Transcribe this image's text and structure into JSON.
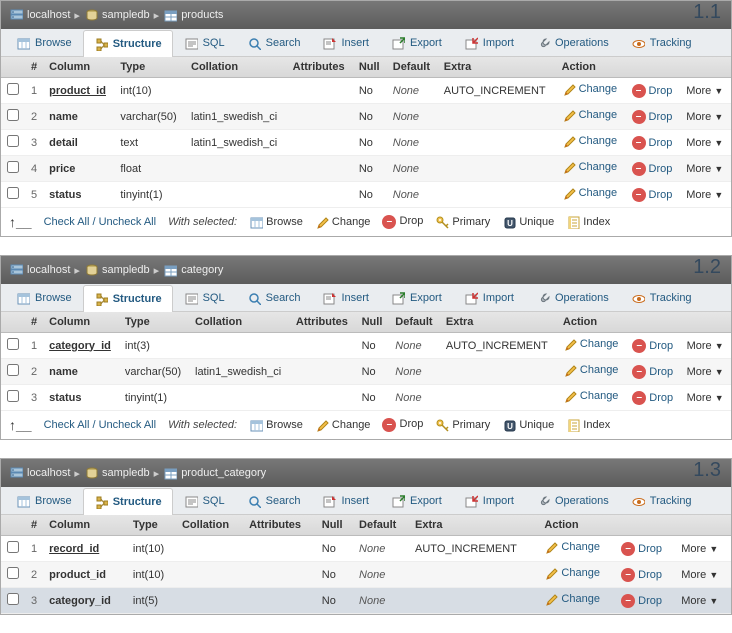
{
  "panels": [
    {
      "num": "1.1",
      "breadcrumb": {
        "host": "localhost",
        "db": "sampledb",
        "table": "products"
      },
      "tabs": {
        "browse": "Browse",
        "structure": "Structure",
        "sql": "SQL",
        "search": "Search",
        "insert": "Insert",
        "export": "Export",
        "import": "Import",
        "operations": "Operations",
        "tracking": "Tracking",
        "active": "structure"
      },
      "headers": {
        "num": "#",
        "column": "Column",
        "type": "Type",
        "collation": "Collation",
        "attributes": "Attributes",
        "null": "Null",
        "default": "Default",
        "extra": "Extra",
        "action": "Action"
      },
      "rows": [
        {
          "n": "1",
          "col": "product_id",
          "pk": true,
          "type": "int(10)",
          "coll": "",
          "attr": "",
          "null": "No",
          "def": "None",
          "extra": "AUTO_INCREMENT"
        },
        {
          "n": "2",
          "col": "name",
          "pk": false,
          "type": "varchar(50)",
          "coll": "latin1_swedish_ci",
          "attr": "",
          "null": "No",
          "def": "None",
          "extra": ""
        },
        {
          "n": "3",
          "col": "detail",
          "pk": false,
          "type": "text",
          "coll": "latin1_swedish_ci",
          "attr": "",
          "null": "No",
          "def": "None",
          "extra": ""
        },
        {
          "n": "4",
          "col": "price",
          "pk": false,
          "type": "float",
          "coll": "",
          "attr": "",
          "null": "No",
          "def": "None",
          "extra": ""
        },
        {
          "n": "5",
          "col": "status",
          "pk": false,
          "type": "tinyint(1)",
          "coll": "",
          "attr": "",
          "null": "No",
          "def": "None",
          "extra": ""
        }
      ],
      "actions": {
        "change": "Change",
        "drop": "Drop",
        "more": "More"
      },
      "footer": {
        "checkall": "Check All / Uncheck All",
        "withsel": "With selected:",
        "browse": "Browse",
        "change": "Change",
        "drop": "Drop",
        "primary": "Primary",
        "unique": "Unique",
        "index": "Index"
      }
    },
    {
      "num": "1.2",
      "breadcrumb": {
        "host": "localhost",
        "db": "sampledb",
        "table": "category"
      },
      "tabs": {
        "browse": "Browse",
        "structure": "Structure",
        "sql": "SQL",
        "search": "Search",
        "insert": "Insert",
        "export": "Export",
        "import": "Import",
        "operations": "Operations",
        "tracking": "Tracking",
        "active": "structure"
      },
      "headers": {
        "num": "#",
        "column": "Column",
        "type": "Type",
        "collation": "Collation",
        "attributes": "Attributes",
        "null": "Null",
        "default": "Default",
        "extra": "Extra",
        "action": "Action"
      },
      "rows": [
        {
          "n": "1",
          "col": "category_id",
          "pk": true,
          "type": "int(3)",
          "coll": "",
          "attr": "",
          "null": "No",
          "def": "None",
          "extra": "AUTO_INCREMENT"
        },
        {
          "n": "2",
          "col": "name",
          "pk": false,
          "type": "varchar(50)",
          "coll": "latin1_swedish_ci",
          "attr": "",
          "null": "No",
          "def": "None",
          "extra": ""
        },
        {
          "n": "3",
          "col": "status",
          "pk": false,
          "type": "tinyint(1)",
          "coll": "",
          "attr": "",
          "null": "No",
          "def": "None",
          "extra": ""
        }
      ],
      "actions": {
        "change": "Change",
        "drop": "Drop",
        "more": "More"
      },
      "footer": {
        "checkall": "Check All / Uncheck All",
        "withsel": "With selected:",
        "browse": "Browse",
        "change": "Change",
        "drop": "Drop",
        "primary": "Primary",
        "unique": "Unique",
        "index": "Index"
      }
    },
    {
      "num": "1.3",
      "breadcrumb": {
        "host": "localhost",
        "db": "sampledb",
        "table": "product_category"
      },
      "tabs": {
        "browse": "Browse",
        "structure": "Structure",
        "sql": "SQL",
        "search": "Search",
        "insert": "Insert",
        "export": "Export",
        "import": "Import",
        "operations": "Operations",
        "tracking": "Tracking",
        "active": "structure"
      },
      "headers": {
        "num": "#",
        "column": "Column",
        "type": "Type",
        "collation": "Collation",
        "attributes": "Attributes",
        "null": "Null",
        "default": "Default",
        "extra": "Extra",
        "action": "Action"
      },
      "rows": [
        {
          "n": "1",
          "col": "record_id",
          "pk": true,
          "type": "int(10)",
          "coll": "",
          "attr": "",
          "null": "No",
          "def": "None",
          "extra": "AUTO_INCREMENT"
        },
        {
          "n": "2",
          "col": "product_id",
          "pk": false,
          "type": "int(10)",
          "coll": "",
          "attr": "",
          "null": "No",
          "def": "None",
          "extra": ""
        },
        {
          "n": "3",
          "col": "category_id",
          "pk": false,
          "type": "int(5)",
          "coll": "",
          "attr": "",
          "null": "No",
          "def": "None",
          "extra": "",
          "sel": true
        }
      ],
      "actions": {
        "change": "Change",
        "drop": "Drop",
        "more": "More"
      },
      "footer": null
    }
  ]
}
